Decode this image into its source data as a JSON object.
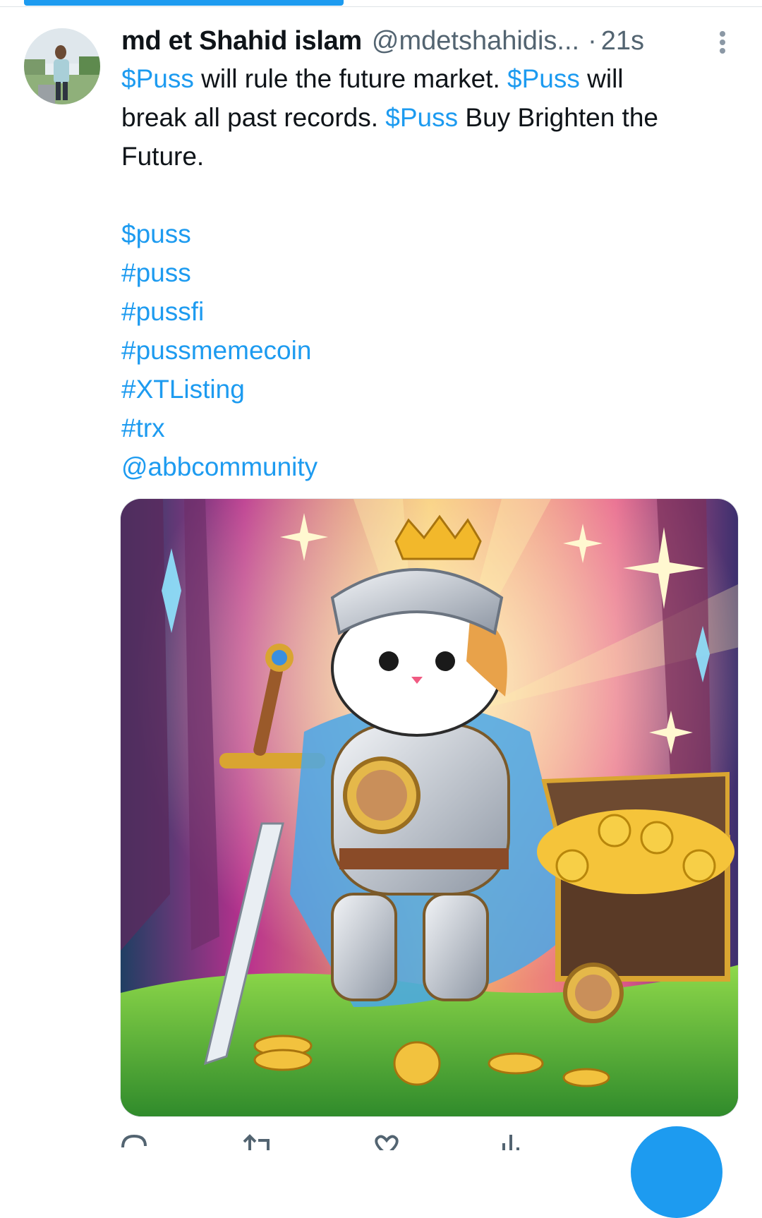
{
  "tweet": {
    "display_name": "md et Shahid islam",
    "handle": "@mdetshahidis...",
    "separator": "·",
    "timestamp": "21s",
    "text": {
      "l1_a": "$Puss",
      "l1_b": " will rule the future market. ",
      "l1_c": "$Puss",
      "l1_d": " will",
      "l2_a": "break all past records.  ",
      "l2_b": "$Puss",
      "l2_c": " Buy Brighten the",
      "l3": "Future."
    },
    "tags": [
      "$puss",
      "#puss",
      "#pussfi",
      "#pussmemecoin",
      "#XTListing",
      "#trx",
      "@abbcommunity"
    ]
  },
  "colors": {
    "accent": "#1d9bf0",
    "secondary_text": "#536471",
    "primary_text": "#0f1419"
  },
  "icons": {
    "more": "more-vertical-icon",
    "reply": "reply-icon",
    "retweet": "retweet-icon",
    "like": "heart-icon",
    "views": "views-icon",
    "compose": "compose-fab"
  }
}
